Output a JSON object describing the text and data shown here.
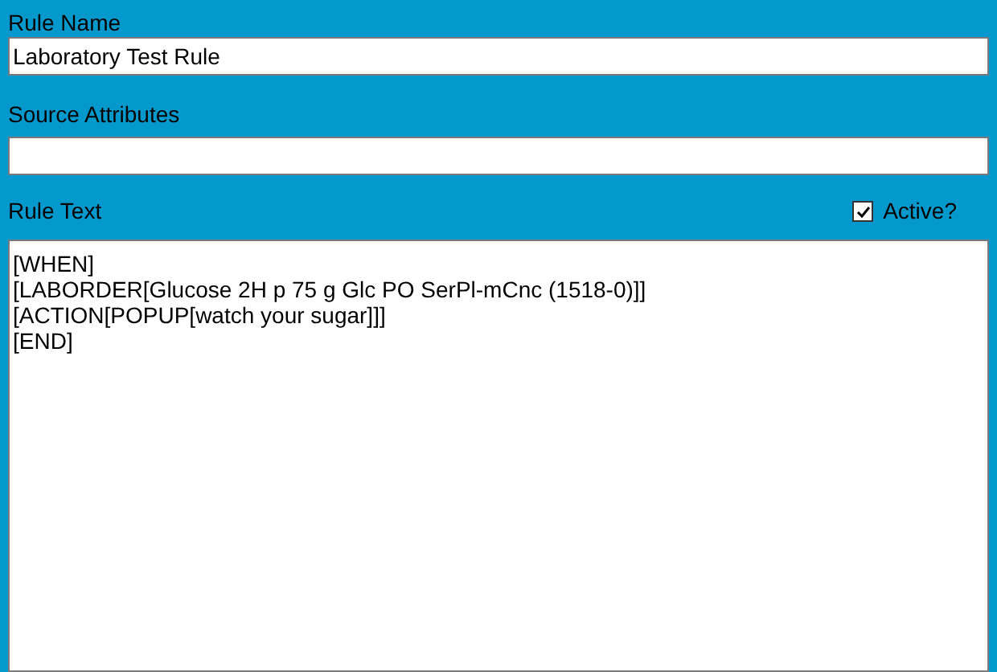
{
  "rule_name": {
    "label": "Rule Name",
    "value": "Laboratory Test Rule"
  },
  "source_attributes": {
    "label": "Source Attributes"
  },
  "rule_text": {
    "label": "Rule Text",
    "active": {
      "label": "Active?",
      "checked": true
    },
    "lines": [
      "[WHEN]",
      "[LABORDER[Glucose 2H p 75 g Glc PO SerPl-mCnc (1518-0)]]",
      "[ACTION[POPUP[watch your sugar]]]",
      "[END]"
    ]
  }
}
